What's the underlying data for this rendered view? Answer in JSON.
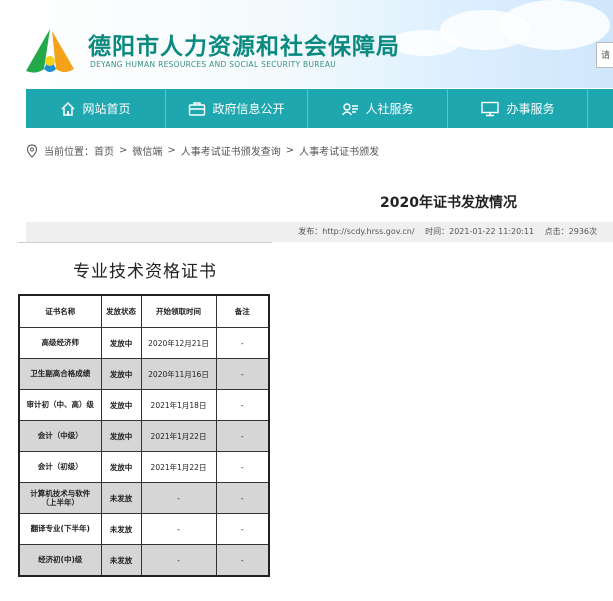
{
  "header": {
    "title": "德阳市人力资源和社会保障局",
    "subtitle": "DEYANG HUMAN RESOURCES AND SOCIAL SECURITY BUREAU",
    "login_hint": "请"
  },
  "nav": {
    "items": [
      {
        "label": "网站首页",
        "icon": "home-icon"
      },
      {
        "label": "政府信息公开",
        "icon": "briefcase-icon"
      },
      {
        "label": "人社服务",
        "icon": "id-card-icon"
      },
      {
        "label": "办事服务",
        "icon": "monitor-icon"
      }
    ]
  },
  "breadcrumb": {
    "prefix": "当前位置：",
    "items": [
      "首页",
      "微信端",
      "人事考试证书颁发查询",
      "人事考试证书颁发"
    ],
    "separator": ">"
  },
  "article": {
    "title": "2020年证书发放情况",
    "meta": {
      "publisher": "发布：http://scdy.hrss.gov.cn/",
      "time": "时间：2021-01-22 11:20:11",
      "clicks": "点击：2936次"
    }
  },
  "certificate_section": {
    "heading": "专业技术资格证书",
    "columns": [
      "证书名称",
      "发放状态",
      "开始领取时间",
      "备注"
    ],
    "rows": [
      {
        "name": "高级经济师",
        "status": "发放中",
        "date": "2020年12月21日",
        "note": "-"
      },
      {
        "name": "卫生副高合格成绩",
        "status": "发放中",
        "date": "2020年11月16日",
        "note": "-"
      },
      {
        "name": "审计初（中、高）级",
        "status": "发放中",
        "date": "2021年1月18日",
        "note": "-"
      },
      {
        "name": "会计（中级）",
        "status": "发放中",
        "date": "2021年1月22日",
        "note": "-"
      },
      {
        "name": "会计（初级）",
        "status": "发放中",
        "date": "2021年1月22日",
        "note": "-"
      },
      {
        "name": "计算机技术与软件（上半年）",
        "status": "未发放",
        "date": "-",
        "note": "-"
      },
      {
        "name": "翻译专业(下半年)",
        "status": "未发放",
        "date": "-",
        "note": "-"
      },
      {
        "name": "经济初(中)级",
        "status": "未发放",
        "date": "-",
        "note": "-"
      }
    ]
  },
  "colors": {
    "brand_teal": "#1fa7b0",
    "title_green": "#0a8a7e",
    "status_red": "#d21a1a",
    "row_gray": "#d6d6d6"
  }
}
